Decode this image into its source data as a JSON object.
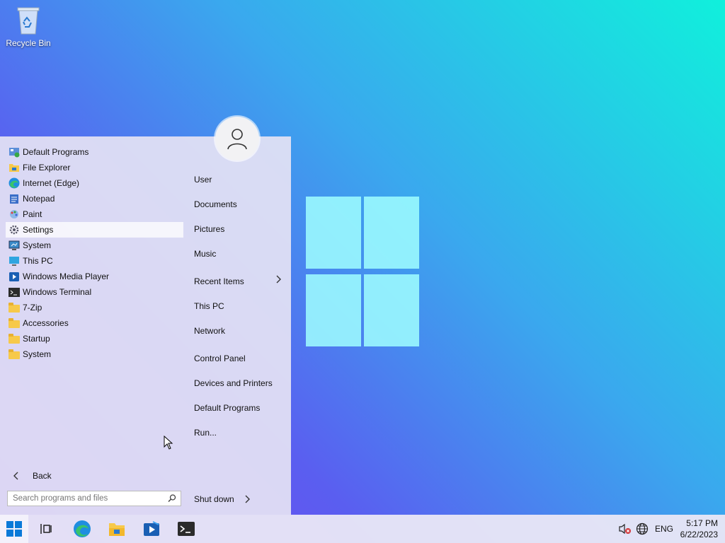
{
  "desktop": {
    "icons": [
      {
        "label": "Recycle Bin",
        "icon": "recycle-bin-icon"
      }
    ]
  },
  "start_menu": {
    "programs": [
      {
        "label": "Default Programs",
        "icon": "default-programs-icon"
      },
      {
        "label": "File Explorer",
        "icon": "file-explorer-icon"
      },
      {
        "label": "Internet (Edge)",
        "icon": "edge-icon"
      },
      {
        "label": "Notepad",
        "icon": "notepad-icon"
      },
      {
        "label": "Paint",
        "icon": "paint-icon"
      },
      {
        "label": "Settings",
        "icon": "gear-icon",
        "selected": true
      },
      {
        "label": "System",
        "icon": "system-icon"
      },
      {
        "label": "This PC",
        "icon": "monitor-icon"
      },
      {
        "label": "Windows Media Player",
        "icon": "media-player-icon"
      },
      {
        "label": "Windows Terminal",
        "icon": "terminal-icon"
      },
      {
        "label": "7-Zip",
        "icon": "folder-icon"
      },
      {
        "label": "Accessories",
        "icon": "folder-icon"
      },
      {
        "label": "Startup",
        "icon": "folder-icon"
      },
      {
        "label": "System",
        "icon": "folder-icon"
      }
    ],
    "places": {
      "user": "User",
      "documents": "Documents",
      "pictures": "Pictures",
      "music": "Music",
      "recent_items": "Recent Items",
      "this_pc": "This PC",
      "network": "Network",
      "control_panel": "Control Panel",
      "devices_printers": "Devices and Printers",
      "default_programs": "Default Programs",
      "run": "Run..."
    },
    "back_label": "Back",
    "search_placeholder": "Search programs and files",
    "shutdown_label": "Shut down"
  },
  "taskbar": {
    "pinned": [
      "start-icon",
      "task-view-icon",
      "edge-icon",
      "file-explorer-icon",
      "media-player-icon",
      "terminal-icon"
    ],
    "language": "ENG",
    "time": "5:17 PM",
    "date": "6/22/2023"
  },
  "colors": {
    "accent": "#0078d4",
    "folder": "#f7c94a",
    "selected_bg": "#ffffff"
  }
}
